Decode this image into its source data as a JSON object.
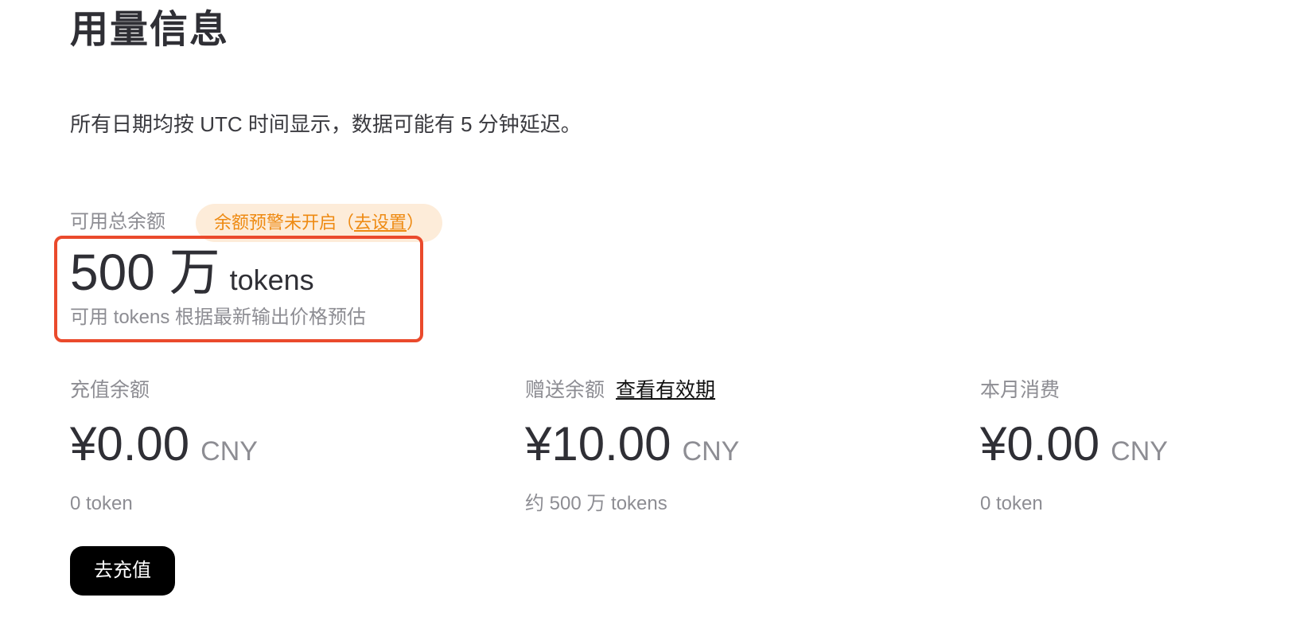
{
  "page": {
    "title": "用量信息",
    "notice": "所有日期均按 UTC 时间显示，数据可能有 5 分钟延迟。"
  },
  "total_balance": {
    "label": "可用总余额",
    "alert_text": "余额预警未开启（",
    "alert_link": "去设置",
    "alert_close": "）",
    "amount": "500 万",
    "unit": "tokens",
    "note": "可用 tokens 根据最新输出价格预估"
  },
  "stats": {
    "recharge": {
      "label": "充值余额",
      "amount": "¥0.00",
      "currency": "CNY",
      "sub": "0 token"
    },
    "gift": {
      "label": "赠送余额",
      "link": "查看有效期",
      "amount": "¥10.00",
      "currency": "CNY",
      "sub": "约 500 万 tokens"
    },
    "monthly": {
      "label": "本月消费",
      "amount": "¥0.00",
      "currency": "CNY",
      "sub": "0 token"
    }
  },
  "actions": {
    "recharge_button": "去充值"
  },
  "colors": {
    "alert_bg": "#fdecd9",
    "alert_text": "#ee8a12",
    "highlight_border": "#ea4a2c",
    "button_bg": "#000000"
  }
}
